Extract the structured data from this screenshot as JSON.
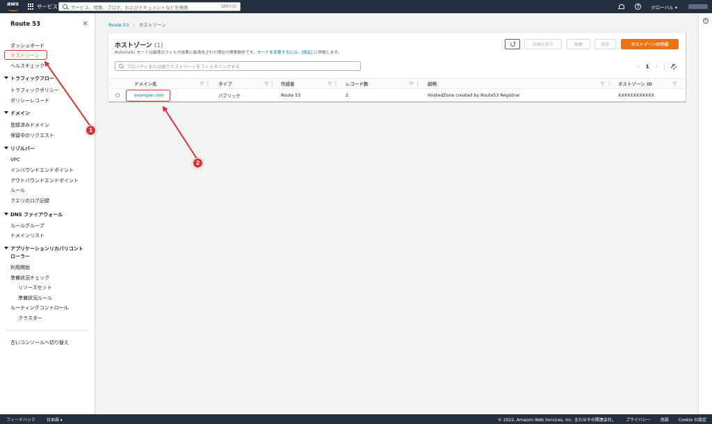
{
  "topnav": {
    "logo": "aws",
    "services_label": "サービス",
    "search_placeholder": "サービス、特徴、ブログ、およびドキュメントなどを検索",
    "search_shortcut": "[Alt+S]",
    "region_label": "グローバル ▾"
  },
  "sidebar": {
    "title": "Route 53",
    "items": {
      "dashboard": "ダッシュボード",
      "hosted_zones": "ホストゾーン",
      "health_checks": "ヘルスチェック",
      "traffic_flow": "トラフィックフロー",
      "traffic_policies": "トラフィックポリシー",
      "policy_records": "ポリシーレコード",
      "domains": "ドメイン",
      "registered_domains": "登録済みドメイン",
      "pending_requests": "保留中のリクエスト",
      "resolver": "リゾルバー",
      "vpc": "VPC",
      "inbound_endpoints": "インバウンドエンドポイント",
      "outbound_endpoints": "アウトバウンドエンドポイント",
      "rules": "ルール",
      "query_logging": "クエリのログ記録",
      "dns_firewall": "DNS ファイアウォール",
      "rule_groups": "ルールグループ",
      "domain_lists": "ドメインリスト",
      "arc_line1": "アプリケーションリカバリコント",
      "arc_line2": "ローラー",
      "getting_started": "利用開始",
      "readiness_check": "準備状況チェック",
      "resource_sets": "リソースセット",
      "readiness_rules": "準備状況ルール",
      "routing_control": "ルーティングコントロール",
      "clusters": "クラスター",
      "old_console": "古いコンソールへ切り替え"
    }
  },
  "breadcrumb": {
    "root": "Route 53",
    "current": "ホストゾーン"
  },
  "panel": {
    "title": "ホストゾーン",
    "count": "(1)",
    "description_prefix": "Automatic モードは最適なフィルタ結果に最適化された現在の検索動作です。",
    "description_link1": "モードを変更するには、",
    "description_link2": "[設定]",
    "description_suffix": " に移動します。",
    "buttons": {
      "view_details": "詳細を表示",
      "edit": "編集",
      "delete": "削除",
      "create": "ホストゾーンの作成"
    },
    "filter_placeholder": "プロパティまたは値でホストゾーンをフィルタリングする",
    "pager": {
      "page": "1",
      "prev": "‹",
      "next": "›"
    },
    "columns": [
      "ドメイン名",
      "タイプ",
      "作成者",
      "レコード数",
      "説明",
      "ホストゾーン ID"
    ],
    "rows": [
      {
        "domain": "example.com",
        "type": "パブリック",
        "created_by": "Route 53",
        "record_count": "2",
        "description": "HostedZone created by Route53 Registrar",
        "zone_id": "XXXXXXXXXXXX"
      }
    ]
  },
  "footer": {
    "feedback": "フィードバック",
    "language": "日本語 ▾",
    "copyright": "© 2022, Amazon Web Services, Inc. またはその関連会社。",
    "privacy": "プライバシー",
    "terms": "用語",
    "cookie": "Cookie の設定"
  },
  "annotations": {
    "badge1": "1",
    "badge2": "2"
  },
  "colors": {
    "accent": "#ec7211",
    "link": "#0073bb",
    "nav": "#232f3e",
    "annotation": "#e02d2d"
  }
}
